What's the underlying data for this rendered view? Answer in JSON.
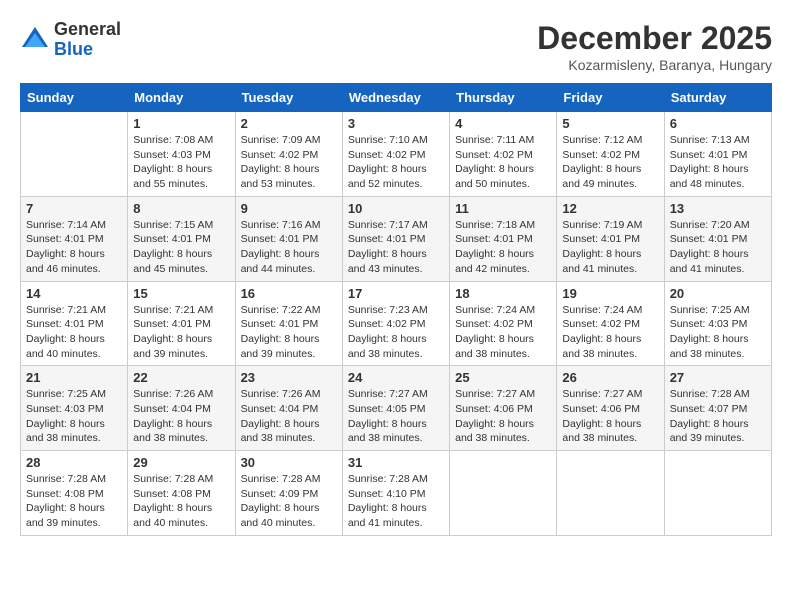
{
  "header": {
    "logo_general": "General",
    "logo_blue": "Blue",
    "title": "December 2025",
    "location": "Kozarmisleny, Baranya, Hungary"
  },
  "calendar": {
    "days_of_week": [
      "Sunday",
      "Monday",
      "Tuesday",
      "Wednesday",
      "Thursday",
      "Friday",
      "Saturday"
    ],
    "weeks": [
      [
        {
          "day": "",
          "sunrise": "",
          "sunset": "",
          "daylight": ""
        },
        {
          "day": "1",
          "sunrise": "Sunrise: 7:08 AM",
          "sunset": "Sunset: 4:03 PM",
          "daylight": "Daylight: 8 hours and 55 minutes."
        },
        {
          "day": "2",
          "sunrise": "Sunrise: 7:09 AM",
          "sunset": "Sunset: 4:02 PM",
          "daylight": "Daylight: 8 hours and 53 minutes."
        },
        {
          "day": "3",
          "sunrise": "Sunrise: 7:10 AM",
          "sunset": "Sunset: 4:02 PM",
          "daylight": "Daylight: 8 hours and 52 minutes."
        },
        {
          "day": "4",
          "sunrise": "Sunrise: 7:11 AM",
          "sunset": "Sunset: 4:02 PM",
          "daylight": "Daylight: 8 hours and 50 minutes."
        },
        {
          "day": "5",
          "sunrise": "Sunrise: 7:12 AM",
          "sunset": "Sunset: 4:02 PM",
          "daylight": "Daylight: 8 hours and 49 minutes."
        },
        {
          "day": "6",
          "sunrise": "Sunrise: 7:13 AM",
          "sunset": "Sunset: 4:01 PM",
          "daylight": "Daylight: 8 hours and 48 minutes."
        }
      ],
      [
        {
          "day": "7",
          "sunrise": "Sunrise: 7:14 AM",
          "sunset": "Sunset: 4:01 PM",
          "daylight": "Daylight: 8 hours and 46 minutes."
        },
        {
          "day": "8",
          "sunrise": "Sunrise: 7:15 AM",
          "sunset": "Sunset: 4:01 PM",
          "daylight": "Daylight: 8 hours and 45 minutes."
        },
        {
          "day": "9",
          "sunrise": "Sunrise: 7:16 AM",
          "sunset": "Sunset: 4:01 PM",
          "daylight": "Daylight: 8 hours and 44 minutes."
        },
        {
          "day": "10",
          "sunrise": "Sunrise: 7:17 AM",
          "sunset": "Sunset: 4:01 PM",
          "daylight": "Daylight: 8 hours and 43 minutes."
        },
        {
          "day": "11",
          "sunrise": "Sunrise: 7:18 AM",
          "sunset": "Sunset: 4:01 PM",
          "daylight": "Daylight: 8 hours and 42 minutes."
        },
        {
          "day": "12",
          "sunrise": "Sunrise: 7:19 AM",
          "sunset": "Sunset: 4:01 PM",
          "daylight": "Daylight: 8 hours and 41 minutes."
        },
        {
          "day": "13",
          "sunrise": "Sunrise: 7:20 AM",
          "sunset": "Sunset: 4:01 PM",
          "daylight": "Daylight: 8 hours and 41 minutes."
        }
      ],
      [
        {
          "day": "14",
          "sunrise": "Sunrise: 7:21 AM",
          "sunset": "Sunset: 4:01 PM",
          "daylight": "Daylight: 8 hours and 40 minutes."
        },
        {
          "day": "15",
          "sunrise": "Sunrise: 7:21 AM",
          "sunset": "Sunset: 4:01 PM",
          "daylight": "Daylight: 8 hours and 39 minutes."
        },
        {
          "day": "16",
          "sunrise": "Sunrise: 7:22 AM",
          "sunset": "Sunset: 4:01 PM",
          "daylight": "Daylight: 8 hours and 39 minutes."
        },
        {
          "day": "17",
          "sunrise": "Sunrise: 7:23 AM",
          "sunset": "Sunset: 4:02 PM",
          "daylight": "Daylight: 8 hours and 38 minutes."
        },
        {
          "day": "18",
          "sunrise": "Sunrise: 7:24 AM",
          "sunset": "Sunset: 4:02 PM",
          "daylight": "Daylight: 8 hours and 38 minutes."
        },
        {
          "day": "19",
          "sunrise": "Sunrise: 7:24 AM",
          "sunset": "Sunset: 4:02 PM",
          "daylight": "Daylight: 8 hours and 38 minutes."
        },
        {
          "day": "20",
          "sunrise": "Sunrise: 7:25 AM",
          "sunset": "Sunset: 4:03 PM",
          "daylight": "Daylight: 8 hours and 38 minutes."
        }
      ],
      [
        {
          "day": "21",
          "sunrise": "Sunrise: 7:25 AM",
          "sunset": "Sunset: 4:03 PM",
          "daylight": "Daylight: 8 hours and 38 minutes."
        },
        {
          "day": "22",
          "sunrise": "Sunrise: 7:26 AM",
          "sunset": "Sunset: 4:04 PM",
          "daylight": "Daylight: 8 hours and 38 minutes."
        },
        {
          "day": "23",
          "sunrise": "Sunrise: 7:26 AM",
          "sunset": "Sunset: 4:04 PM",
          "daylight": "Daylight: 8 hours and 38 minutes."
        },
        {
          "day": "24",
          "sunrise": "Sunrise: 7:27 AM",
          "sunset": "Sunset: 4:05 PM",
          "daylight": "Daylight: 8 hours and 38 minutes."
        },
        {
          "day": "25",
          "sunrise": "Sunrise: 7:27 AM",
          "sunset": "Sunset: 4:06 PM",
          "daylight": "Daylight: 8 hours and 38 minutes."
        },
        {
          "day": "26",
          "sunrise": "Sunrise: 7:27 AM",
          "sunset": "Sunset: 4:06 PM",
          "daylight": "Daylight: 8 hours and 38 minutes."
        },
        {
          "day": "27",
          "sunrise": "Sunrise: 7:28 AM",
          "sunset": "Sunset: 4:07 PM",
          "daylight": "Daylight: 8 hours and 39 minutes."
        }
      ],
      [
        {
          "day": "28",
          "sunrise": "Sunrise: 7:28 AM",
          "sunset": "Sunset: 4:08 PM",
          "daylight": "Daylight: 8 hours and 39 minutes."
        },
        {
          "day": "29",
          "sunrise": "Sunrise: 7:28 AM",
          "sunset": "Sunset: 4:08 PM",
          "daylight": "Daylight: 8 hours and 40 minutes."
        },
        {
          "day": "30",
          "sunrise": "Sunrise: 7:28 AM",
          "sunset": "Sunset: 4:09 PM",
          "daylight": "Daylight: 8 hours and 40 minutes."
        },
        {
          "day": "31",
          "sunrise": "Sunrise: 7:28 AM",
          "sunset": "Sunset: 4:10 PM",
          "daylight": "Daylight: 8 hours and 41 minutes."
        },
        {
          "day": "",
          "sunrise": "",
          "sunset": "",
          "daylight": ""
        },
        {
          "day": "",
          "sunrise": "",
          "sunset": "",
          "daylight": ""
        },
        {
          "day": "",
          "sunrise": "",
          "sunset": "",
          "daylight": ""
        }
      ]
    ]
  }
}
